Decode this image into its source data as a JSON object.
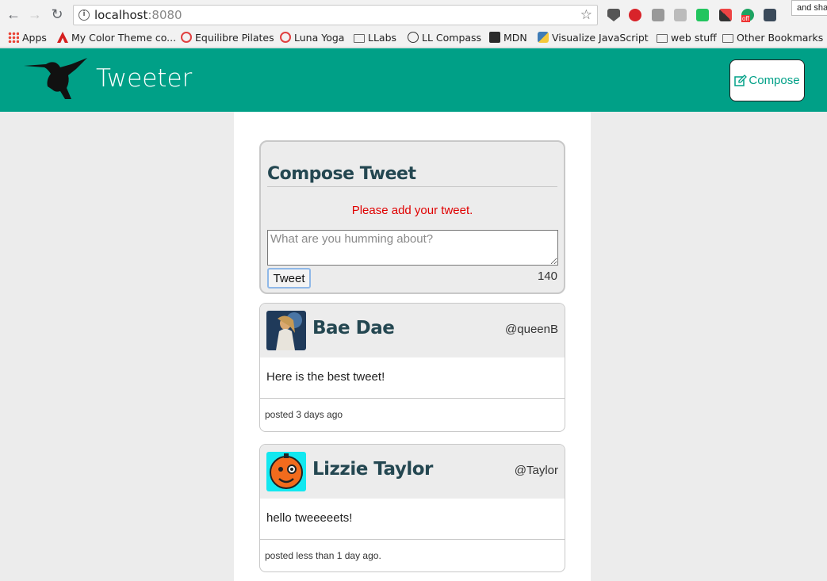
{
  "browser": {
    "url_host": "localhost",
    "url_port": ":8080",
    "tooltip": "and sha",
    "bookmarks": [
      {
        "label": "Apps",
        "icon": "apps-icon"
      },
      {
        "label": "My Color Theme co...",
        "icon": "adobe-icon"
      },
      {
        "label": "Equilibre Pilates",
        "icon": "ring-icon"
      },
      {
        "label": "Luna Yoga",
        "icon": "ring-icon"
      },
      {
        "label": "LLabs",
        "icon": "folder-icon"
      },
      {
        "label": "LL Compass",
        "icon": "compass-icon"
      },
      {
        "label": "MDN",
        "icon": "mdn-icon"
      },
      {
        "label": "Visualize JavaScript",
        "icon": "python-icon"
      },
      {
        "label": "web stuff",
        "icon": "folder-icon"
      },
      {
        "label": "Other Bookmarks",
        "icon": "folder-icon"
      }
    ],
    "extension_badge": "off"
  },
  "nav": {
    "brand": "Tweeter",
    "compose_label": "Compose",
    "accent_color": "#00a087"
  },
  "compose": {
    "title": "Compose Tweet",
    "error": "Please add your tweet.",
    "placeholder": "What are you humming about?",
    "submit_label": "Tweet",
    "counter": "140"
  },
  "tweets": [
    {
      "name": "Bae Dae",
      "handle": "@queenB",
      "body": "Here is the best tweet!",
      "footer": "posted 3 days ago"
    },
    {
      "name": "Lizzie Taylor",
      "handle": "@Taylor",
      "body": "hello tweeeeets!",
      "footer": "posted less than 1 day ago."
    }
  ]
}
